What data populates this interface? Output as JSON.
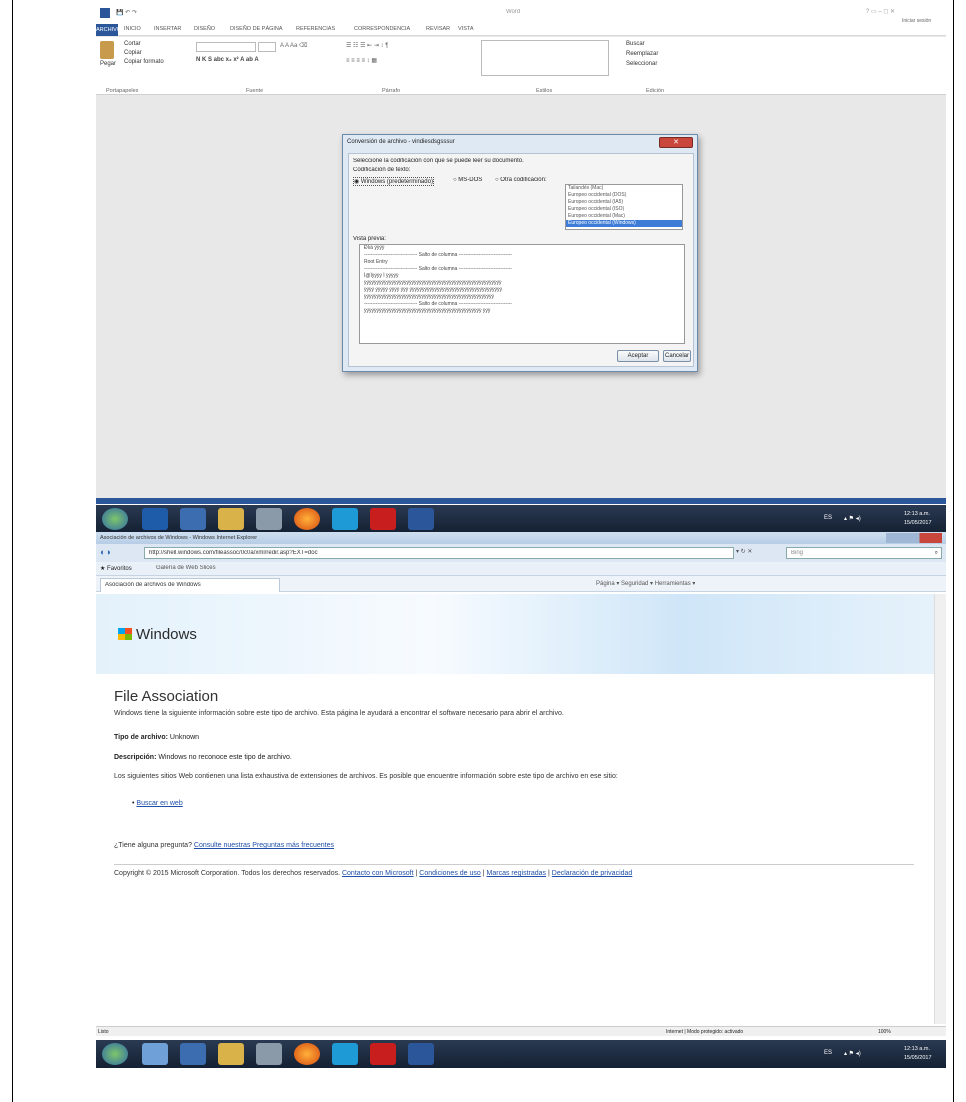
{
  "word": {
    "title": "Word",
    "window_buttons": "? ▭ – ◻ ✕",
    "user": "Iniciar sesión",
    "tabs": [
      "ARCHIVO",
      "INICIO",
      "INSERTAR",
      "DISEÑO",
      "DISEÑO DE PÁGINA",
      "REFERENCIAS",
      "CORRESPONDENCIA",
      "REVISAR",
      "VISTA"
    ],
    "ribbon": {
      "paste": "Pegar",
      "cut": "Cortar",
      "copy": "Copiar",
      "format_painter": "Copiar formato",
      "find": "Buscar",
      "replace": "Reemplazar",
      "select": "Seleccionar",
      "groups": [
        "Portapapeles",
        "Fuente",
        "Párrafo",
        "Estilos",
        "Edición"
      ]
    },
    "dialog": {
      "title": "Conversión de archivo - vindiesdsgsssur",
      "close": "✕",
      "prompt": "Seleccione la codificación con que se puede leer su documento.",
      "encoding_label": "Codificación de texto:",
      "options": [
        "Windows (predeterminado)",
        "MS-DOS",
        "Otra codificación:"
      ],
      "list": [
        "Tailandés (Mac)",
        "Europeo occidental (DOS)",
        "Europeo occidental (IA5)",
        "Europeo occidental (ISO)",
        "Europeo occidental (Mac)",
        "Europeo occidental (Windows)"
      ],
      "preview_label": "Vista previa:",
      "preview_lines": [
        "ÐÏࡱá ÿÿÿÿ",
        "-------------------------------- Salto de columna --------------------------------",
        "Root Entry",
        "-------------------------------- Salto de columna --------------------------------",
        "Ì@Ìÿÿÿÿ Ì ÿÿÿÿÿ",
        "ÿÿÿÿÿÿÿÿÿÿÿÿÿÿÿÿÿÿÿÿÿÿÿÿÿÿÿÿÿÿÿÿÿÿÿÿÿÿÿÿÿÿÿÿÿÿÿÿÿÿÿÿÿÿÿ",
        "ÿÿÿÿ ÿÿÿÿÿ ÿÿÿÿ ÿÿÿ ÿÿÿÿÿÿÿÿÿÿÿÿÿÿÿÿÿÿÿÿÿÿÿÿÿÿÿÿÿÿÿÿÿÿÿÿÿ",
        "ÿÿÿÿÿÿÿÿÿÿÿÿÿÿÿÿÿÿÿÿÿÿÿÿÿÿÿÿÿÿÿÿÿÿÿÿÿÿÿÿÿÿÿÿÿÿÿÿÿÿÿÿ",
        "-------------------------------- Salto de columna --------------------------------",
        "ÿÿÿÿÿÿÿÿÿÿÿÿÿÿÿÿÿÿÿÿÿÿÿÿÿÿÿÿÿÿÿÿÿÿÿÿÿÿÿÿÿÿÿÿÿÿÿ ÿÿÿ"
      ],
      "accept": "Aceptar",
      "cancel": "Cancelar"
    }
  },
  "taskbar": {
    "lang": "ES",
    "time": "12:13 a.m.",
    "date": "15/05/2017"
  },
  "ie": {
    "title": "Asociación de archivos de Windows - Windows Internet Explorer",
    "url": "http://shell.windows.com/fileassoc/0c0a/xml/redir.asp?EXT=doc",
    "search_placeholder": "Bing",
    "favorites": "Favoritos",
    "fav_item": "Galería de Web Slices",
    "tab": "Asociación de archivos de Windows",
    "commands": "Página ▾  Seguridad ▾  Herramientas ▾",
    "brand": "Windows",
    "heading": "File Association",
    "intro": "Windows tiene la siguiente información sobre este tipo de archivo. Esta página le ayudará a encontrar el software necesario para abrir el archivo.",
    "type_label": "Tipo de archivo:",
    "type_value": "Unknown",
    "desc_label": "Descripción:",
    "desc_value": "Windows no reconoce este tipo de archivo.",
    "sites_text": "Los siguientes sitios Web contienen una lista exhaustiva de extensiones de archivos. Es posible que encuentre información sobre este tipo de archivo en ese sitio:",
    "search_link": "Buscar en web",
    "faq_q": "¿Tiene alguna pregunta?",
    "faq_link": "Consulte nuestras Preguntas más frecuentes",
    "copyright": "Copyright © 2015 Microsoft Corporation. Todos los derechos reservados.",
    "footer_links": [
      "Contacto con Microsoft",
      "Condiciones de uso",
      "Marcas registradas",
      "Declaración de privacidad"
    ],
    "status": "Listo",
    "zone": "Internet | Modo protegido: activado",
    "zoom": "100%"
  },
  "colors": {
    "word_blue": "#2b579a",
    "taskbar": "#1b2a40",
    "link": "#1f4fa8"
  }
}
